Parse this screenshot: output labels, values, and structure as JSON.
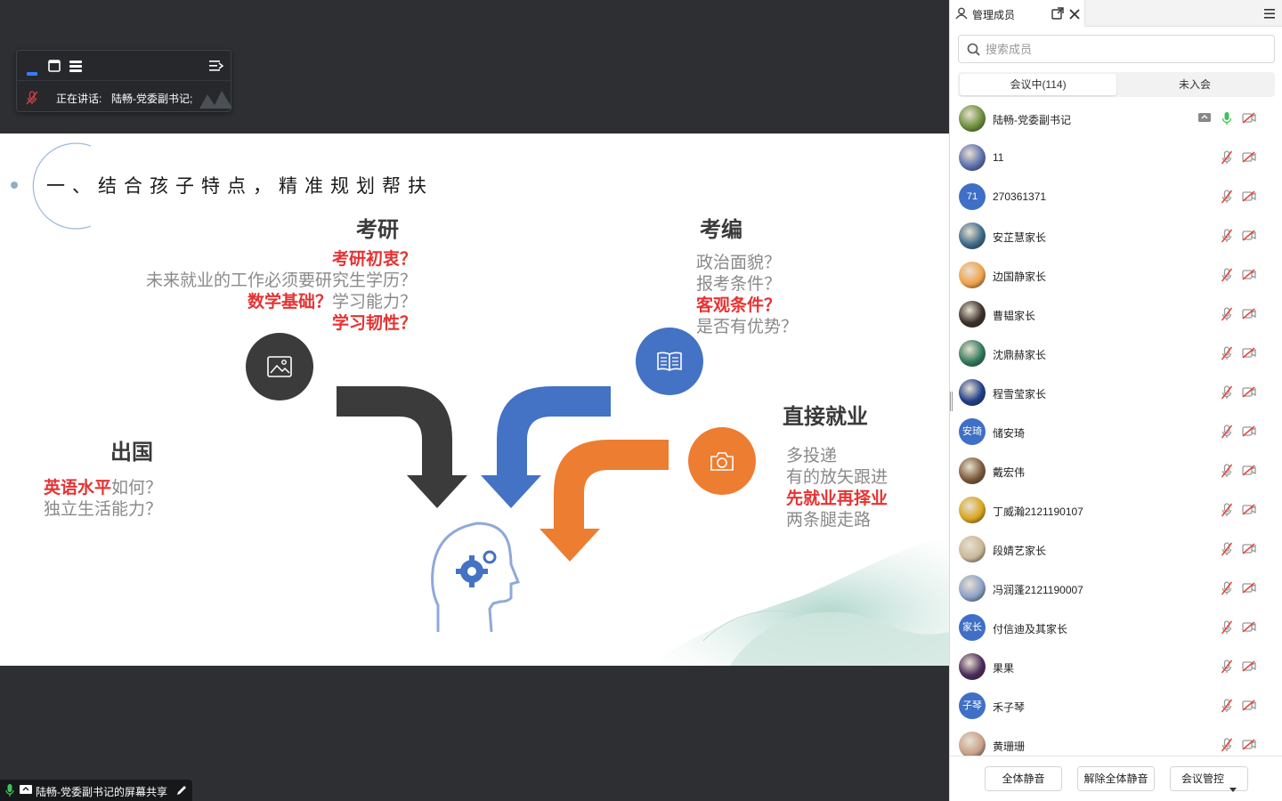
{
  "floating_bar": {
    "speaking_label": "正在讲话:",
    "speaker": "陆畅-党委副书记;"
  },
  "slide": {
    "title": "一、结合孩子特点，精准规划帮扶",
    "kaoyan": {
      "heading": "考研",
      "lines": [
        {
          "parts": [
            {
              "t": "考研初衷？",
              "red": true
            }
          ]
        },
        {
          "parts": [
            {
              "t": "未来就业的工作必须要研究生学历？",
              "red": false
            }
          ]
        },
        {
          "parts": [
            {
              "t": "数学基础？",
              "red": true
            },
            {
              "t": "学习能力？",
              "red": false
            }
          ]
        },
        {
          "parts": [
            {
              "t": "学习韧性？",
              "red": true
            }
          ]
        }
      ]
    },
    "kaobian": {
      "heading": "考编",
      "lines": [
        {
          "parts": [
            {
              "t": "政治面貌？",
              "red": false
            }
          ]
        },
        {
          "parts": [
            {
              "t": "报考条件？",
              "red": false
            }
          ]
        },
        {
          "parts": [
            {
              "t": "客观条件？",
              "red": true
            }
          ]
        },
        {
          "parts": [
            {
              "t": "是否有优势？",
              "red": false
            }
          ]
        }
      ]
    },
    "chuguo": {
      "heading": "出国",
      "lines": [
        {
          "parts": [
            {
              "t": "英语水平",
              "red": true
            },
            {
              "t": "如何？",
              "red": false
            }
          ]
        },
        {
          "parts": [
            {
              "t": "独立生活能力？",
              "red": false
            }
          ]
        }
      ]
    },
    "jiuye": {
      "heading": "直接就业",
      "lines": [
        {
          "parts": [
            {
              "t": "多投递",
              "red": false
            }
          ]
        },
        {
          "parts": [
            {
              "t": "有的放矢跟进",
              "red": false
            }
          ]
        },
        {
          "parts": [
            {
              "t": "先就业再择业",
              "red": true
            }
          ]
        },
        {
          "parts": [
            {
              "t": "两条腿走路",
              "red": false
            }
          ]
        }
      ]
    },
    "colors": {
      "dark": "#3b3b3b",
      "blue": "#4472c4",
      "orange": "#ed7d31",
      "red": "#e53333",
      "head_outline": "#8ea9db"
    }
  },
  "bottom_bar": {
    "label": "陆畅-党委副书记的屏幕共享"
  },
  "panel": {
    "tab_title": "管理成员",
    "search_placeholder": "搜索成员",
    "segments": [
      "会议中(114)",
      "未入会"
    ],
    "members": [
      {
        "name": "陆畅-党委副书记",
        "avatar": "photo",
        "color": "#6b8e3a",
        "mic": "on",
        "sharing": true
      },
      {
        "name": "11",
        "avatar": "photo",
        "color": "#5b6fb0",
        "mic": "off"
      },
      {
        "name": "270361371",
        "avatar": "text",
        "avatar_text": "71",
        "color": "#3f6fc6",
        "mic": "off"
      },
      {
        "name": "安芷慧家长",
        "avatar": "photo",
        "color": "#3c6a8a",
        "mic": "off"
      },
      {
        "name": "边国静家长",
        "avatar": "photo",
        "color": "#f0a24a",
        "mic": "off"
      },
      {
        "name": "曹韫家长",
        "avatar": "photo",
        "color": "#3a2f2a",
        "mic": "off"
      },
      {
        "name": "沈鼎赫家长",
        "avatar": "photo",
        "color": "#2f7a5a",
        "mic": "off"
      },
      {
        "name": "程雪莹家长",
        "avatar": "photo",
        "color": "#1f3f8a",
        "mic": "off"
      },
      {
        "name": "储安琦",
        "avatar": "text",
        "avatar_text": "安琦",
        "color": "#3f6fc6",
        "mic": "off"
      },
      {
        "name": "戴宏伟",
        "avatar": "photo",
        "color": "#7a5a3a",
        "mic": "off"
      },
      {
        "name": "丁威瀚2121190107",
        "avatar": "photo",
        "color": "#d9a520",
        "mic": "off"
      },
      {
        "name": "段婧艺家长",
        "avatar": "photo",
        "color": "#c9b89a",
        "mic": "off"
      },
      {
        "name": "冯润蓬2121190007",
        "avatar": "photo",
        "color": "#8aa0c8",
        "mic": "off"
      },
      {
        "name": "付信迪及其家长",
        "avatar": "text",
        "avatar_text": "家长",
        "color": "#3f6fc6",
        "mic": "off"
      },
      {
        "name": "果果",
        "avatar": "photo",
        "color": "#4a2a5a",
        "mic": "off"
      },
      {
        "name": "禾子琴",
        "avatar": "text",
        "avatar_text": "子琴",
        "color": "#3f6fc6",
        "mic": "off"
      },
      {
        "name": "黄珊珊",
        "avatar": "photo",
        "color": "#c8a08a",
        "mic": "off"
      }
    ],
    "footer": {
      "mute_all": "全体静音",
      "unmute_all": "解除全体静音",
      "control": "会议管控"
    }
  }
}
